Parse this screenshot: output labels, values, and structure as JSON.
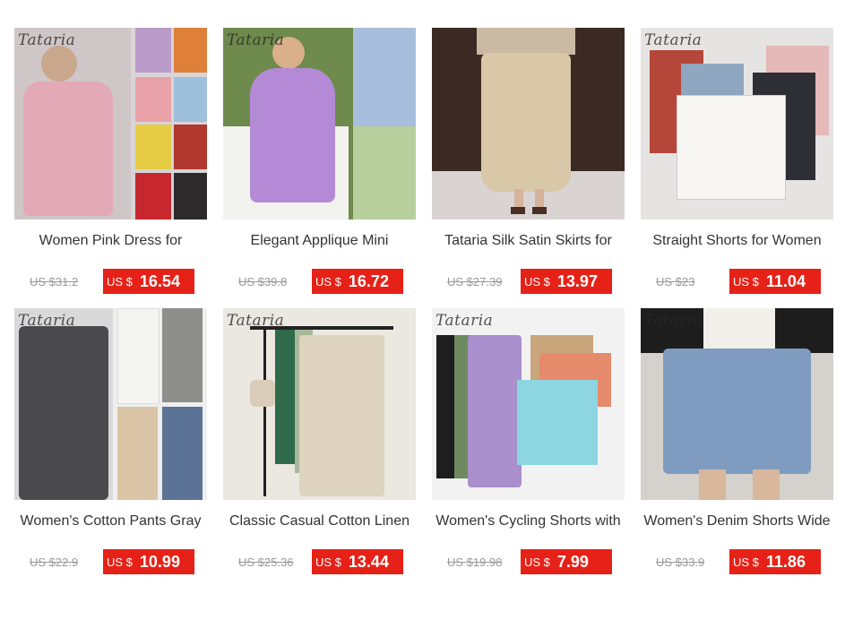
{
  "brand_watermark": "Tataria",
  "currency": "US $",
  "colors": {
    "sale_bg": "#e62117",
    "text": "#333333",
    "strike": "#999999"
  },
  "products": [
    {
      "title": "Women Pink Dress for",
      "original_price": "US $31.2",
      "price": "16.54"
    },
    {
      "title": "Elegant Applique Mini",
      "original_price": "US $39.8",
      "price": "16.72"
    },
    {
      "title": "Tataria Silk Satin Skirts for",
      "original_price": "US $27.39",
      "price": "13.97"
    },
    {
      "title": "Straight Shorts for Women",
      "original_price": "US $23",
      "price": "11.04"
    },
    {
      "title": "Women's Cotton Pants Gray",
      "original_price": "US $22.9",
      "price": "10.99"
    },
    {
      "title": "Classic Casual Cotton Linen",
      "original_price": "US $25.36",
      "price": "13.44"
    },
    {
      "title": "Women's Cycling Shorts with",
      "original_price": "US $19.98",
      "price": "7.99"
    },
    {
      "title": "Women's Denim Shorts Wide",
      "original_price": "US $33.9",
      "price": "11.86"
    }
  ]
}
